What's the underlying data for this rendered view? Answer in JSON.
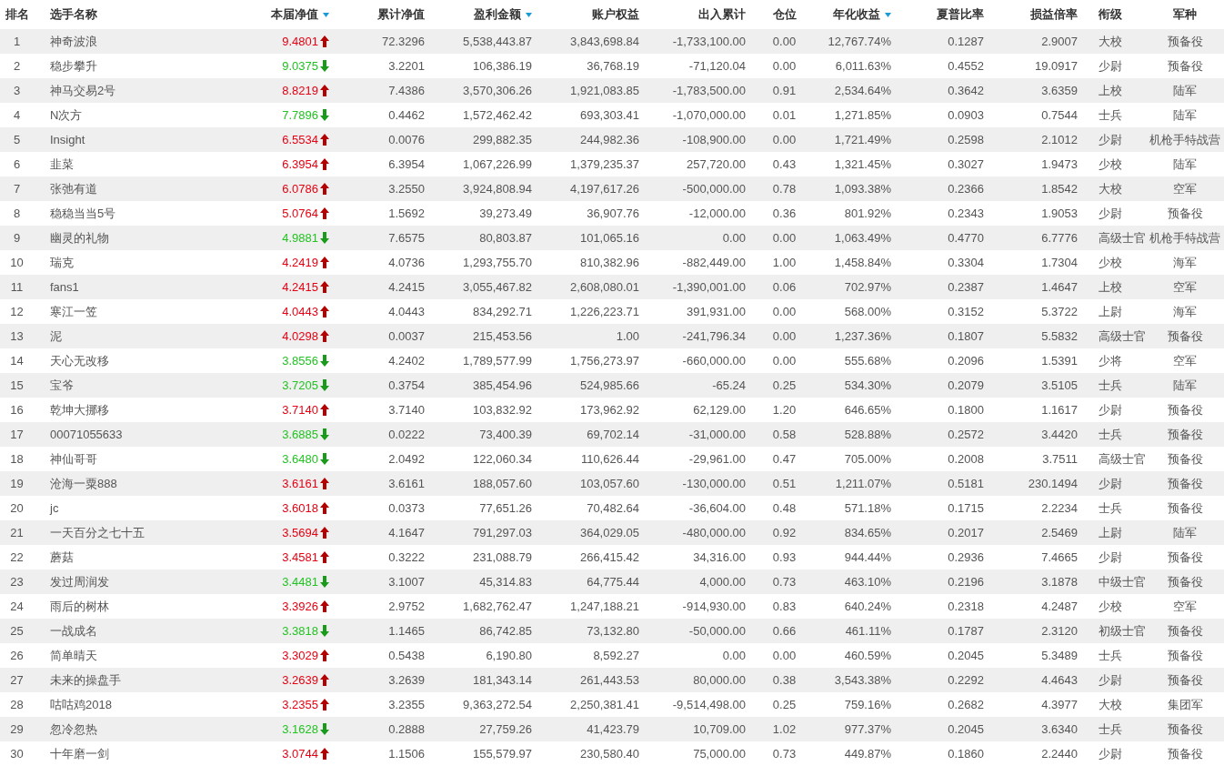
{
  "table": {
    "columns": [
      {
        "label": "排名",
        "sorted": false
      },
      {
        "label": "选手名称",
        "sorted": false
      },
      {
        "label": "本届净值",
        "sorted": true
      },
      {
        "label": "累计净值",
        "sorted": false
      },
      {
        "label": "盈利金额",
        "sorted": true
      },
      {
        "label": "账户权益",
        "sorted": false
      },
      {
        "label": "出入累计",
        "sorted": false
      },
      {
        "label": "仓位",
        "sorted": false
      },
      {
        "label": "年化收益",
        "sorted": true
      },
      {
        "label": "夏普比率",
        "sorted": false
      },
      {
        "label": "损益倍率",
        "sorted": false
      },
      {
        "label": "衔级",
        "sorted": false
      },
      {
        "label": "军种",
        "sorted": false
      }
    ],
    "rows": [
      {
        "kind": "up",
        "cells": [
          "1",
          "神奇波浪",
          "9.4801",
          "72.3296",
          "5,538,443.87",
          "3,843,698.84",
          "-1,733,100.00",
          "0.00",
          "12,767.74%",
          "0.1287",
          "2.9007",
          "大校",
          "预备役"
        ]
      },
      {
        "kind": "down",
        "cells": [
          "2",
          "稳步攀升",
          "9.0375",
          "3.2201",
          "106,386.19",
          "36,768.19",
          "-71,120.04",
          "0.00",
          "6,011.63%",
          "0.4552",
          "19.0917",
          "少尉",
          "预备役"
        ]
      },
      {
        "kind": "up",
        "cells": [
          "3",
          "神马交易2号",
          "8.8219",
          "7.4386",
          "3,570,306.26",
          "1,921,083.85",
          "-1,783,500.00",
          "0.91",
          "2,534.64%",
          "0.3642",
          "3.6359",
          "上校",
          "陆军"
        ]
      },
      {
        "kind": "down",
        "cells": [
          "4",
          "N次方",
          "7.7896",
          "0.4462",
          "1,572,462.42",
          "693,303.41",
          "-1,070,000.00",
          "0.01",
          "1,271.85%",
          "0.0903",
          "0.7544",
          "士兵",
          "陆军"
        ]
      },
      {
        "kind": "up",
        "cells": [
          "5",
          "Insight",
          "6.5534",
          "0.0076",
          "299,882.35",
          "244,982.36",
          "-108,900.00",
          "0.00",
          "1,721.49%",
          "0.2598",
          "2.1012",
          "少尉",
          "机枪手特战营"
        ]
      },
      {
        "kind": "up",
        "cells": [
          "6",
          "韭菜",
          "6.3954",
          "6.3954",
          "1,067,226.99",
          "1,379,235.37",
          "257,720.00",
          "0.43",
          "1,321.45%",
          "0.3027",
          "1.9473",
          "少校",
          "陆军"
        ]
      },
      {
        "kind": "up",
        "cells": [
          "7",
          "张弛有道",
          "6.0786",
          "3.2550",
          "3,924,808.94",
          "4,197,617.26",
          "-500,000.00",
          "0.78",
          "1,093.38%",
          "0.2366",
          "1.8542",
          "大校",
          "空军"
        ]
      },
      {
        "kind": "up",
        "cells": [
          "8",
          "稳稳当当5号",
          "5.0764",
          "1.5692",
          "39,273.49",
          "36,907.76",
          "-12,000.00",
          "0.36",
          "801.92%",
          "0.2343",
          "1.9053",
          "少尉",
          "预备役"
        ]
      },
      {
        "kind": "down",
        "cells": [
          "9",
          "幽灵的礼物",
          "4.9881",
          "7.6575",
          "80,803.87",
          "101,065.16",
          "0.00",
          "0.00",
          "1,063.49%",
          "0.4770",
          "6.7776",
          "高级士官",
          "机枪手特战营"
        ]
      },
      {
        "kind": "up",
        "cells": [
          "10",
          "瑞克",
          "4.2419",
          "4.0736",
          "1,293,755.70",
          "810,382.96",
          "-882,449.00",
          "1.00",
          "1,458.84%",
          "0.3304",
          "1.7304",
          "少校",
          "海军"
        ]
      },
      {
        "kind": "up",
        "cells": [
          "11",
          "fans1",
          "4.2415",
          "4.2415",
          "3,055,467.82",
          "2,608,080.01",
          "-1,390,001.00",
          "0.06",
          "702.97%",
          "0.2387",
          "1.4647",
          "上校",
          "空军"
        ]
      },
      {
        "kind": "up",
        "cells": [
          "12",
          "寒江一笠",
          "4.0443",
          "4.0443",
          "834,292.71",
          "1,226,223.71",
          "391,931.00",
          "0.00",
          "568.00%",
          "0.3152",
          "5.3722",
          "上尉",
          "海军"
        ]
      },
      {
        "kind": "up",
        "cells": [
          "13",
          "泥",
          "4.0298",
          "0.0037",
          "215,453.56",
          "1.00",
          "-241,796.34",
          "0.00",
          "1,237.36%",
          "0.1807",
          "5.5832",
          "高级士官",
          "预备役"
        ]
      },
      {
        "kind": "down",
        "cells": [
          "14",
          "天心无改移",
          "3.8556",
          "4.2402",
          "1,789,577.99",
          "1,756,273.97",
          "-660,000.00",
          "0.00",
          "555.68%",
          "0.2096",
          "1.5391",
          "少将",
          "空军"
        ]
      },
      {
        "kind": "down",
        "cells": [
          "15",
          "宝爷",
          "3.7205",
          "0.3754",
          "385,454.96",
          "524,985.66",
          "-65.24",
          "0.25",
          "534.30%",
          "0.2079",
          "3.5105",
          "士兵",
          "陆军"
        ]
      },
      {
        "kind": "up",
        "cells": [
          "16",
          "乾坤大挪移",
          "3.7140",
          "3.7140",
          "103,832.92",
          "173,962.92",
          "62,129.00",
          "1.20",
          "646.65%",
          "0.1800",
          "1.1617",
          "少尉",
          "预备役"
        ]
      },
      {
        "kind": "down",
        "cells": [
          "17",
          "00071055633",
          "3.6885",
          "0.0222",
          "73,400.39",
          "69,702.14",
          "-31,000.00",
          "0.58",
          "528.88%",
          "0.2572",
          "3.4420",
          "士兵",
          "预备役"
        ]
      },
      {
        "kind": "down",
        "cells": [
          "18",
          "神仙哥哥",
          "3.6480",
          "2.0492",
          "122,060.34",
          "110,626.44",
          "-29,961.00",
          "0.47",
          "705.00%",
          "0.2008",
          "3.7511",
          "高级士官",
          "预备役"
        ]
      },
      {
        "kind": "up",
        "cells": [
          "19",
          "沧海一粟888",
          "3.6161",
          "3.6161",
          "188,057.60",
          "103,057.60",
          "-130,000.00",
          "0.51",
          "1,211.07%",
          "0.5181",
          "230.1494",
          "少尉",
          "预备役"
        ]
      },
      {
        "kind": "up",
        "cells": [
          "20",
          "jc",
          "3.6018",
          "0.0373",
          "77,651.26",
          "70,482.64",
          "-36,604.00",
          "0.48",
          "571.18%",
          "0.1715",
          "2.2234",
          "士兵",
          "预备役"
        ]
      },
      {
        "kind": "up",
        "cells": [
          "21",
          "一天百分之七十五",
          "3.5694",
          "4.1647",
          "791,297.03",
          "364,029.05",
          "-480,000.00",
          "0.92",
          "834.65%",
          "0.2017",
          "2.5469",
          "上尉",
          "陆军"
        ]
      },
      {
        "kind": "up",
        "cells": [
          "22",
          "蘑菇",
          "3.4581",
          "0.3222",
          "231,088.79",
          "266,415.42",
          "34,316.00",
          "0.93",
          "944.44%",
          "0.2936",
          "7.4665",
          "少尉",
          "预备役"
        ]
      },
      {
        "kind": "down",
        "cells": [
          "23",
          "发过周润发",
          "3.4481",
          "3.1007",
          "45,314.83",
          "64,775.44",
          "4,000.00",
          "0.73",
          "463.10%",
          "0.2196",
          "3.1878",
          "中级士官",
          "预备役"
        ]
      },
      {
        "kind": "up",
        "cells": [
          "24",
          "雨后的树林",
          "3.3926",
          "2.9752",
          "1,682,762.47",
          "1,247,188.21",
          "-914,930.00",
          "0.83",
          "640.24%",
          "0.2318",
          "4.2487",
          "少校",
          "空军"
        ]
      },
      {
        "kind": "down",
        "cells": [
          "25",
          "一战成名",
          "3.3818",
          "1.1465",
          "86,742.85",
          "73,132.80",
          "-50,000.00",
          "0.66",
          "461.11%",
          "0.1787",
          "2.3120",
          "初级士官",
          "预备役"
        ]
      },
      {
        "kind": "up",
        "cells": [
          "26",
          "简单晴天",
          "3.3029",
          "0.5438",
          "6,190.80",
          "8,592.27",
          "0.00",
          "0.00",
          "460.59%",
          "0.2045",
          "5.3489",
          "士兵",
          "预备役"
        ]
      },
      {
        "kind": "up",
        "cells": [
          "27",
          "未来的操盘手",
          "3.2639",
          "3.2639",
          "181,343.14",
          "261,443.53",
          "80,000.00",
          "0.38",
          "3,543.38%",
          "0.2292",
          "4.4643",
          "少尉",
          "预备役"
        ]
      },
      {
        "kind": "up",
        "cells": [
          "28",
          "咕咕鸡2018",
          "3.2355",
          "3.2355",
          "9,363,272.54",
          "2,250,381.41",
          "-9,514,498.00",
          "0.25",
          "759.16%",
          "0.2682",
          "4.3977",
          "大校",
          "集团军"
        ]
      },
      {
        "kind": "down",
        "cells": [
          "29",
          "忽冷忽热",
          "3.1628",
          "0.2888",
          "27,759.26",
          "41,423.79",
          "10,709.00",
          "1.02",
          "977.37%",
          "0.2045",
          "3.6340",
          "士兵",
          "预备役"
        ]
      },
      {
        "kind": "up",
        "cells": [
          "30",
          "十年磨一剑",
          "3.0744",
          "1.1506",
          "155,579.97",
          "230,580.40",
          "75,000.00",
          "0.73",
          "449.87%",
          "0.1860",
          "2.2440",
          "少尉",
          "预备役"
        ]
      }
    ]
  }
}
